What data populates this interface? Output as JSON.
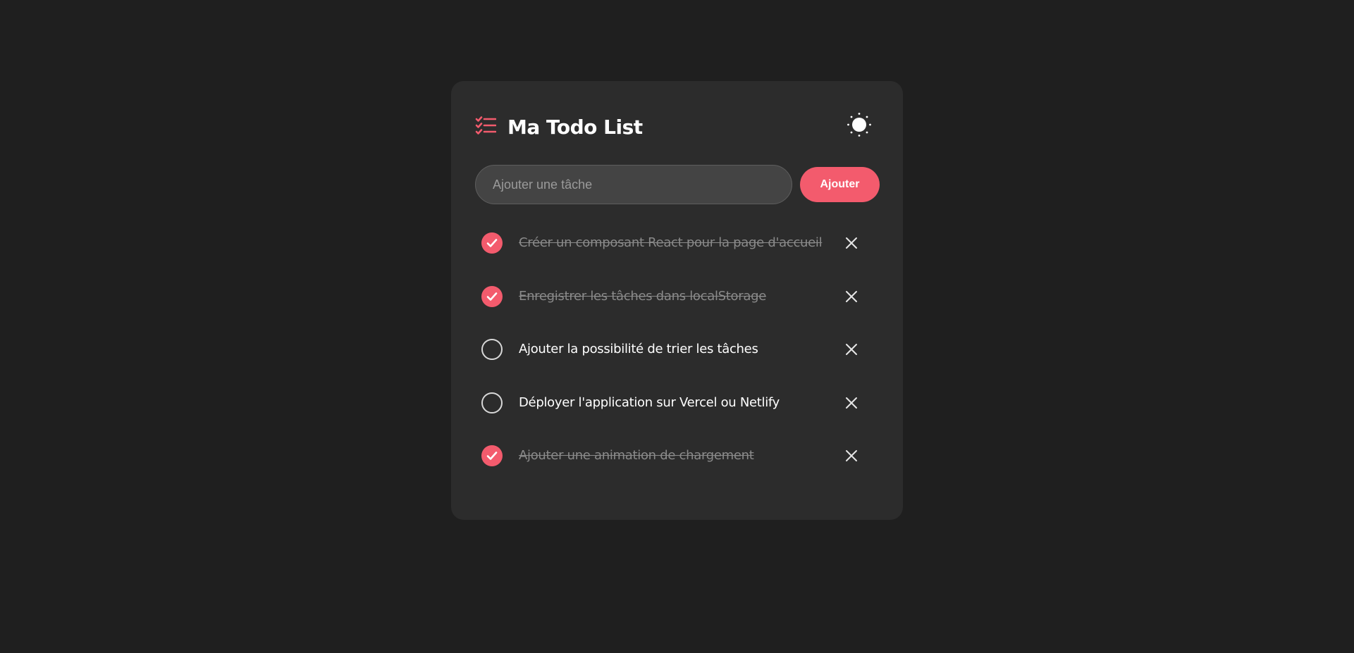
{
  "header": {
    "title": "Ma Todo List",
    "logo_icon": "checklist-icon",
    "theme_icon": "sun-icon"
  },
  "add_form": {
    "input_placeholder": "Ajouter une tâche",
    "input_value": "",
    "button_label": "Ajouter"
  },
  "todos": [
    {
      "text": "Créer un composant React pour la page d'accueil",
      "done": true
    },
    {
      "text": "Enregistrer les tâches dans localStorage",
      "done": true
    },
    {
      "text": "Ajouter la possibilité de trier les tâches",
      "done": false
    },
    {
      "text": "Déployer l'application sur Vercel ou Netlify",
      "done": false
    },
    {
      "text": "Ajouter une animation de chargement",
      "done": true
    }
  ],
  "colors": {
    "background": "#1f1f1f",
    "card": "#2c2c2c",
    "accent": "#f35b6d",
    "input_bg": "#444444",
    "text": "#ffffff",
    "text_done": "#8a8a8a"
  }
}
